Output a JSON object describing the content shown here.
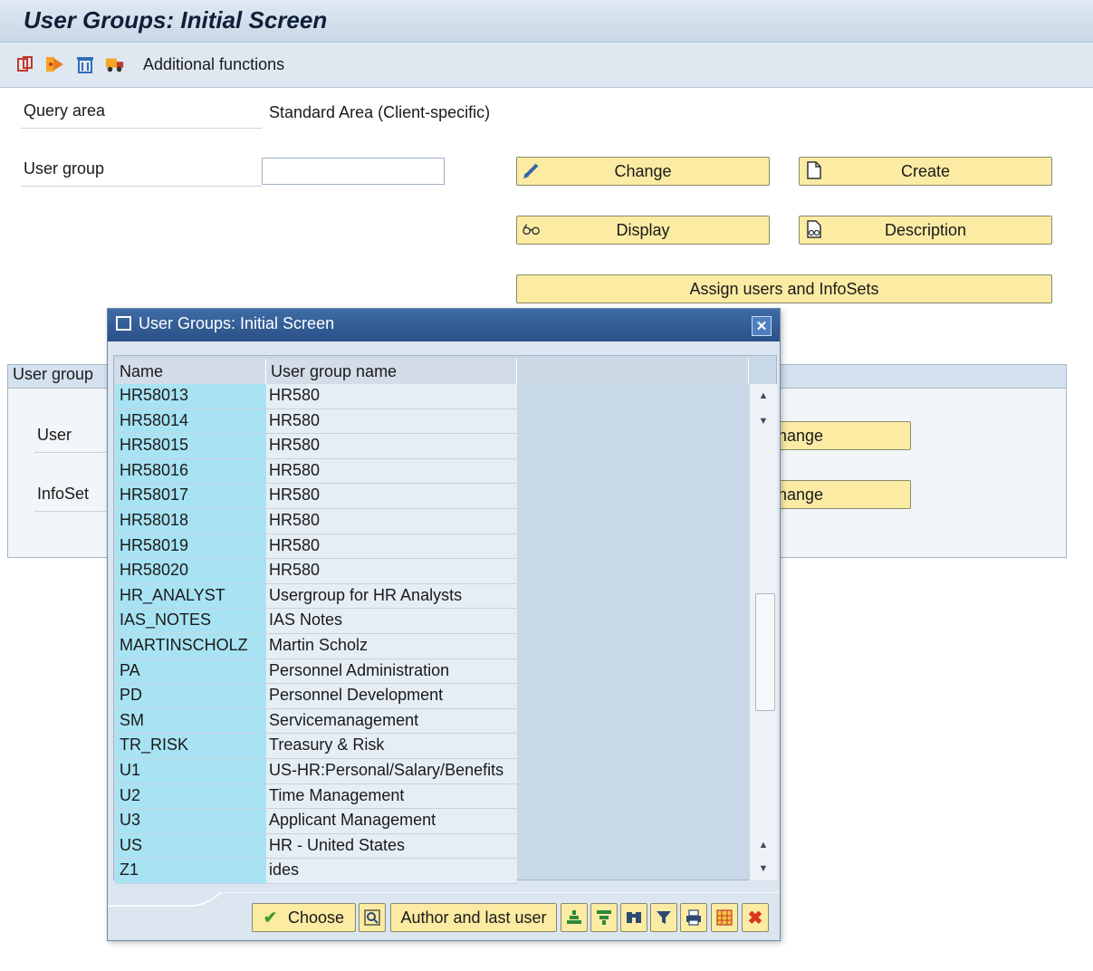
{
  "window": {
    "title": "User Groups: Initial Screen"
  },
  "toolbar": {
    "icons": [
      "copy-icon",
      "execute-icon",
      "delete-icon",
      "transport-icon"
    ],
    "additional_functions": "Additional functions"
  },
  "form": {
    "query_area_label": "Query area",
    "query_area_value": "Standard Area (Client-specific)",
    "user_group_label": "User group",
    "user_group_value": "",
    "buttons": {
      "change": "Change",
      "create": "Create",
      "display": "Display",
      "description": "Description",
      "assign": "Assign users and InfoSets"
    }
  },
  "background_group": {
    "tab_label": "User group",
    "user_label": "User",
    "infoset_label": "InfoSet",
    "change_user_partial": "hange",
    "change_infoset_partial": "hange"
  },
  "dialog": {
    "title": "User Groups: Initial Screen",
    "columns": [
      "Name",
      "User group name"
    ],
    "rows": [
      [
        "HR58013",
        "HR580"
      ],
      [
        "HR58014",
        "HR580"
      ],
      [
        "HR58015",
        "HR580"
      ],
      [
        "HR58016",
        "HR580"
      ],
      [
        "HR58017",
        "HR580"
      ],
      [
        "HR58018",
        "HR580"
      ],
      [
        "HR58019",
        "HR580"
      ],
      [
        "HR58020",
        "HR580"
      ],
      [
        "HR_ANALYST",
        "Usergroup for HR Analysts"
      ],
      [
        "IAS_NOTES",
        "IAS Notes"
      ],
      [
        "MARTINSCHOLZ",
        "Martin Scholz"
      ],
      [
        "PA",
        "Personnel Administration"
      ],
      [
        "PD",
        "Personnel Development"
      ],
      [
        "SM",
        "Servicemanagement"
      ],
      [
        "TR_RISK",
        "Treasury & Risk"
      ],
      [
        "U1",
        "US-HR:Personal/Salary/Benefits"
      ],
      [
        "U2",
        "Time Management"
      ],
      [
        "U3",
        "Applicant Management"
      ],
      [
        "US",
        "HR - United States"
      ],
      [
        "Z1",
        "ides"
      ]
    ],
    "footer": {
      "choose": "Choose",
      "author_last_user": "Author and last user"
    }
  },
  "colors": {
    "button_bg": "#fbeba3",
    "title_bar": "#2a5088",
    "key_column": "#a8e3f3"
  }
}
